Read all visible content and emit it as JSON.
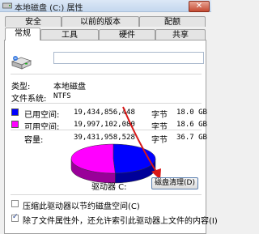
{
  "window": {
    "title": "本地磁盘 (C:) 属性",
    "close_label": "✕"
  },
  "tabs_row1": [
    {
      "label": "安全"
    },
    {
      "label": "以前的版本"
    },
    {
      "label": "配额"
    }
  ],
  "tabs_row2": [
    {
      "label": "常规",
      "active": true
    },
    {
      "label": "工具"
    },
    {
      "label": "硬件"
    },
    {
      "label": "共享"
    }
  ],
  "general": {
    "drive_name_value": "",
    "type_label": "类型:",
    "type_value": "本地磁盘",
    "fs_label": "文件系统:",
    "fs_value": "NTFS",
    "used": {
      "label": "已用空间:",
      "bytes": "19,434,856,448",
      "unit": "字节",
      "size": "18.0 GB",
      "color": "#0000ff"
    },
    "free": {
      "label": "可用空间:",
      "bytes": "19,997,102,080",
      "unit": "字节",
      "size": "18.6 GB",
      "color": "#ff00ff"
    },
    "capacity": {
      "label": "容量:",
      "bytes": "39,431,958,528",
      "unit": "字节",
      "size": "36.7 GB"
    },
    "drive_label": "驱动器 C:",
    "cleanup_button": "磁盘清理(D)",
    "compress_option": {
      "label": "压缩此驱动器以节约磁盘空间(C)",
      "checked": false
    },
    "index_option": {
      "label": "除了文件属性外，还允许索引此驱动器上文件的内容(I)",
      "checked": true
    }
  },
  "chart_data": {
    "type": "pie",
    "categories": [
      "已用空间",
      "可用空间"
    ],
    "values": [
      19434856448,
      19997102080
    ],
    "colors": [
      "#0000ff",
      "#ff00ff"
    ]
  }
}
